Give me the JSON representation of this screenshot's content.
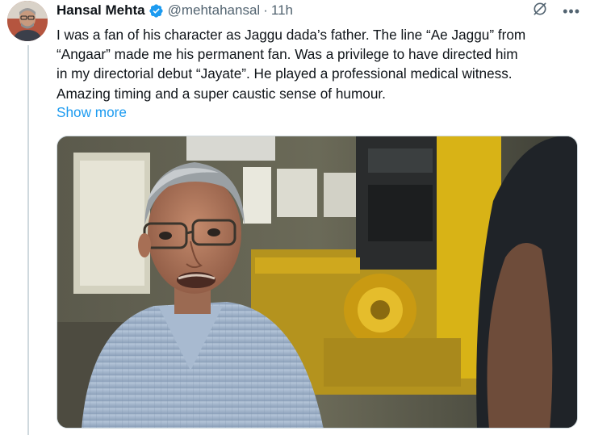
{
  "author": {
    "name": "Hansal Mehta",
    "handle": "@mehtahansal",
    "separator": "·",
    "time": "11h",
    "verified": true
  },
  "tweet": {
    "lines": [
      "I was a fan of his character as Jaggu dada’s father. The line “Ae Jaggu” from",
      "“Angaar” made me his permanent fan. Was a privilege to have directed him",
      "in my directorial debut “Jayate”. He played a professional medical witness.",
      "Amazing timing and a super caustic sense of humour."
    ],
    "show_more": "Show more"
  },
  "icons": {
    "verified": "verified-badge-icon",
    "grok": "grok-icon",
    "more": "more-options-icon"
  },
  "colors": {
    "link": "#1d9bf0",
    "secondary_text": "#536471",
    "verified": "#1d9bf0"
  }
}
